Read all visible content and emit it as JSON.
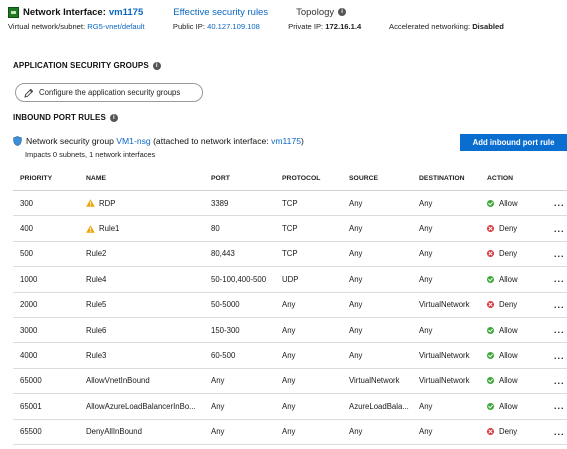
{
  "header": {
    "title_label": "Network Interface:",
    "nic_name": "vm1175",
    "tab_effective": "Effective security rules",
    "tab_topology": "Topology"
  },
  "subline": {
    "vnet_label": "Virtual network/subnet:",
    "vnet_value": "RG5-vnet/default",
    "public_ip_label": "Public IP:",
    "public_ip_value": "40.127.109.108",
    "private_ip_label": "Private IP:",
    "private_ip_value": "172.16.1.4",
    "accel_label": "Accelerated networking:",
    "accel_value": "Disabled"
  },
  "asg": {
    "title": "APPLICATION SECURITY GROUPS",
    "configure_label": "Configure the application security groups"
  },
  "inbound": {
    "title": "INBOUND PORT RULES",
    "nsg_prefix": "Network security group",
    "nsg_name": "VM1-nsg",
    "nsg_attached": "(attached to network interface:",
    "nsg_nic": "vm1175",
    "nsg_close": ")",
    "impacts": "Impacts 0 subnets, 1 network interfaces",
    "add_button": "Add inbound port rule"
  },
  "table": {
    "columns": [
      "PRIORITY",
      "NAME",
      "PORT",
      "PROTOCOL",
      "SOURCE",
      "DESTINATION",
      "ACTION"
    ],
    "more_label": "...",
    "rows": [
      {
        "priority": "300",
        "name": "RDP",
        "warn": true,
        "port": "3389",
        "protocol": "TCP",
        "source": "Any",
        "destination": "Any",
        "action": "Allow",
        "status": "allow"
      },
      {
        "priority": "400",
        "name": "Rule1",
        "warn": true,
        "port": "80",
        "protocol": "TCP",
        "source": "Any",
        "destination": "Any",
        "action": "Deny",
        "status": "deny"
      },
      {
        "priority": "500",
        "name": "Rule2",
        "warn": false,
        "port": "80,443",
        "protocol": "TCP",
        "source": "Any",
        "destination": "Any",
        "action": "Deny",
        "status": "deny"
      },
      {
        "priority": "1000",
        "name": "Rule4",
        "warn": false,
        "port": "50-100,400-500",
        "protocol": "UDP",
        "source": "Any",
        "destination": "Any",
        "action": "Allow",
        "status": "allow"
      },
      {
        "priority": "2000",
        "name": "Rule5",
        "warn": false,
        "port": "50-5000",
        "protocol": "Any",
        "source": "Any",
        "destination": "VirtualNetwork",
        "action": "Deny",
        "status": "deny"
      },
      {
        "priority": "3000",
        "name": "Rule6",
        "warn": false,
        "port": "150-300",
        "protocol": "Any",
        "source": "Any",
        "destination": "Any",
        "action": "Allow",
        "status": "allow"
      },
      {
        "priority": "4000",
        "name": "Rule3",
        "warn": false,
        "port": "60-500",
        "protocol": "Any",
        "source": "Any",
        "destination": "VirtualNetwork",
        "action": "Allow",
        "status": "allow"
      },
      {
        "priority": "65000",
        "name": "AllowVnetInBound",
        "warn": false,
        "port": "Any",
        "protocol": "Any",
        "source": "VirtualNetwork",
        "destination": "VirtualNetwork",
        "action": "Allow",
        "status": "allow"
      },
      {
        "priority": "65001",
        "name": "AllowAzureLoadBalancerInBo...",
        "warn": false,
        "port": "Any",
        "protocol": "Any",
        "source": "AzureLoadBala...",
        "destination": "Any",
        "action": "Allow",
        "status": "allow"
      },
      {
        "priority": "65500",
        "name": "DenyAllInBound",
        "warn": false,
        "port": "Any",
        "protocol": "Any",
        "source": "Any",
        "destination": "Any",
        "action": "Deny",
        "status": "deny"
      }
    ]
  },
  "icons": {
    "nic": "network-interface-icon",
    "info": "info-icon",
    "pencil": "pencil-icon",
    "shield": "shield-icon",
    "warning": "warning-icon",
    "allow": "check-circle-icon",
    "deny": "x-circle-icon"
  },
  "colors": {
    "link": "#0b67c2",
    "primary_button": "#0a6ed1",
    "allow": "#3ea83a",
    "deny": "#d8333a",
    "warning": "#f0a30a"
  }
}
